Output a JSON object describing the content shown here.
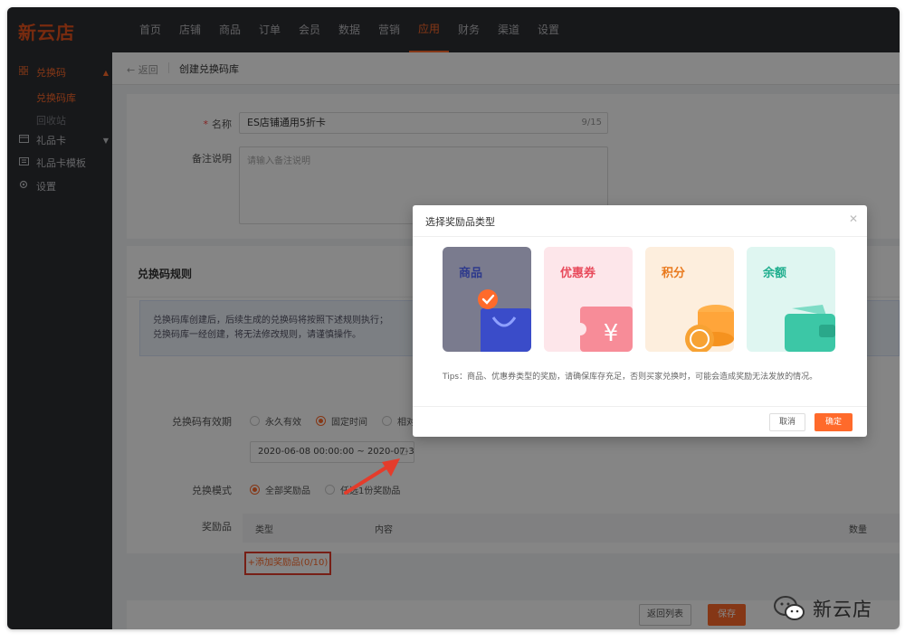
{
  "app": {
    "logo": "新云店"
  },
  "topnav": {
    "items": [
      "首页",
      "店铺",
      "商品",
      "订单",
      "会员",
      "数据",
      "营销",
      "应用",
      "财务",
      "渠道",
      "设置"
    ],
    "active": "应用"
  },
  "sidebar": {
    "redeem": "兑换码",
    "redeem_lib": "兑换码库",
    "recycle": "回收站",
    "giftcard": "礼品卡",
    "giftcard_tpl": "礼品卡模板",
    "settings": "设置"
  },
  "page": {
    "back": "返回",
    "title": "创建兑换码库"
  },
  "form": {
    "name_label": "名称",
    "name_value": "ES店铺通用5折卡",
    "name_counter": "9/15",
    "remark_label": "备注说明",
    "remark_placeholder": "请输入备注说明"
  },
  "rules": {
    "title": "兑换码规则",
    "notice_line1": "兑换码库创建后，后续生成的兑换码将按照下述规则执行；",
    "notice_line2": "兑换码库一经创建，将无法修改规则，请谨慎操作。",
    "validity_label": "兑换码有效期",
    "validity_options": [
      "永久有效",
      "固定时间",
      "相对时间"
    ],
    "validity_selected": "固定时间",
    "date_range": "2020-06-08 00:00:00 ~ 2020-07-3",
    "mode_label": "兑换模式",
    "mode_options": [
      "全部奖励品",
      "任选1份奖励品"
    ],
    "mode_selected": "全部奖励品",
    "reward_label": "奖励品",
    "table_headers": {
      "type": "类型",
      "content": "内容",
      "qty": "数量"
    },
    "add_reward": "+添加奖励品(0/10)"
  },
  "footer": {
    "back_list": "返回列表",
    "save": "保存"
  },
  "modal": {
    "title": "选择奖励品类型",
    "cards": {
      "goods": "商品",
      "coupon": "优惠券",
      "points": "积分",
      "balance": "余额"
    },
    "selected": "商品",
    "tips": "Tips：商品、优惠券类型的奖励，请确保库存充足，否则买家兑换时，可能会造成奖励无法发放的情况。",
    "cancel": "取消",
    "ok": "确定"
  },
  "watermark": {
    "text": "新云店"
  },
  "colors": {
    "accent": "#ff6a2b",
    "dark_nav": "#2d2e33",
    "annotation_red": "#e43c2b"
  }
}
